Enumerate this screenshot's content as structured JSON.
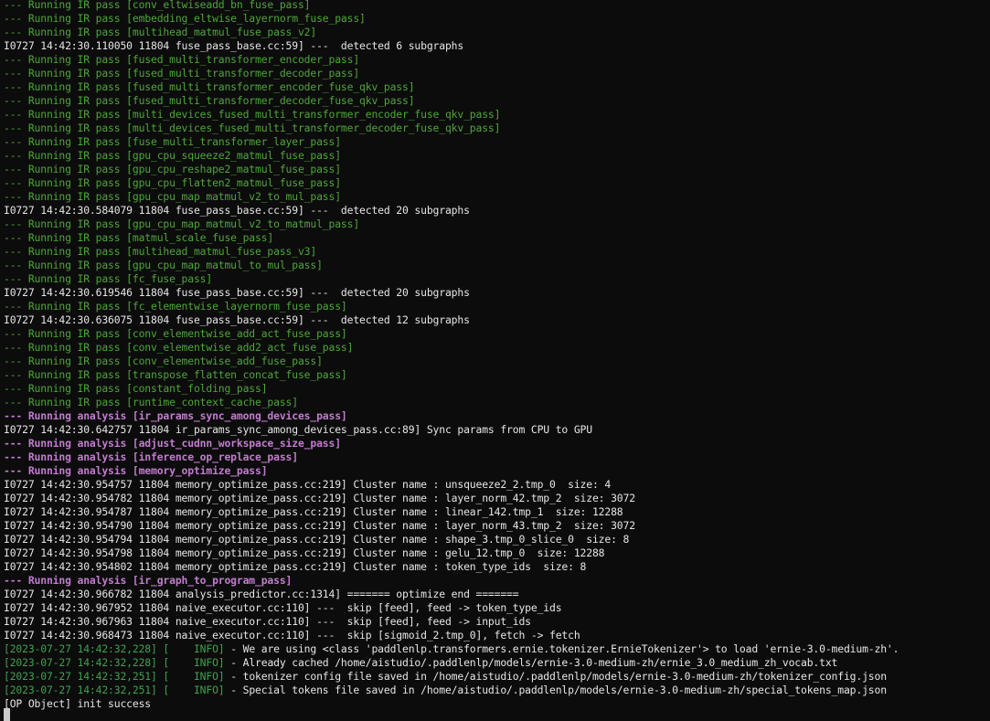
{
  "terminal": {
    "lines": [
      {
        "color": "green",
        "text": "--- Running IR pass [conv_eltwiseadd_bn_fuse_pass]"
      },
      {
        "color": "green",
        "text": "--- Running IR pass [embedding_eltwise_layernorm_fuse_pass]"
      },
      {
        "color": "green",
        "text": "--- Running IR pass [multihead_matmul_fuse_pass_v2]"
      },
      {
        "color": "white",
        "text": "I0727 14:42:30.110050 11804 fuse_pass_base.cc:59] ---  detected 6 subgraphs"
      },
      {
        "color": "green",
        "text": "--- Running IR pass [fused_multi_transformer_encoder_pass]"
      },
      {
        "color": "green",
        "text": "--- Running IR pass [fused_multi_transformer_decoder_pass]"
      },
      {
        "color": "green",
        "text": "--- Running IR pass [fused_multi_transformer_encoder_fuse_qkv_pass]"
      },
      {
        "color": "green",
        "text": "--- Running IR pass [fused_multi_transformer_decoder_fuse_qkv_pass]"
      },
      {
        "color": "green",
        "text": "--- Running IR pass [multi_devices_fused_multi_transformer_encoder_fuse_qkv_pass]"
      },
      {
        "color": "green",
        "text": "--- Running IR pass [multi_devices_fused_multi_transformer_decoder_fuse_qkv_pass]"
      },
      {
        "color": "green",
        "text": "--- Running IR pass [fuse_multi_transformer_layer_pass]"
      },
      {
        "color": "green",
        "text": "--- Running IR pass [gpu_cpu_squeeze2_matmul_fuse_pass]"
      },
      {
        "color": "green",
        "text": "--- Running IR pass [gpu_cpu_reshape2_matmul_fuse_pass]"
      },
      {
        "color": "green",
        "text": "--- Running IR pass [gpu_cpu_flatten2_matmul_fuse_pass]"
      },
      {
        "color": "green",
        "text": "--- Running IR pass [gpu_cpu_map_matmul_v2_to_mul_pass]"
      },
      {
        "color": "white",
        "text": "I0727 14:42:30.584079 11804 fuse_pass_base.cc:59] ---  detected 20 subgraphs"
      },
      {
        "color": "green",
        "text": "--- Running IR pass [gpu_cpu_map_matmul_v2_to_matmul_pass]"
      },
      {
        "color": "green",
        "text": "--- Running IR pass [matmul_scale_fuse_pass]"
      },
      {
        "color": "green",
        "text": "--- Running IR pass [multihead_matmul_fuse_pass_v3]"
      },
      {
        "color": "green",
        "text": "--- Running IR pass [gpu_cpu_map_matmul_to_mul_pass]"
      },
      {
        "color": "green",
        "text": "--- Running IR pass [fc_fuse_pass]"
      },
      {
        "color": "white",
        "text": "I0727 14:42:30.619546 11804 fuse_pass_base.cc:59] ---  detected 20 subgraphs"
      },
      {
        "color": "green",
        "text": "--- Running IR pass [fc_elementwise_layernorm_fuse_pass]"
      },
      {
        "color": "white",
        "text": "I0727 14:42:30.636075 11804 fuse_pass_base.cc:59] ---  detected 12 subgraphs"
      },
      {
        "color": "green",
        "text": "--- Running IR pass [conv_elementwise_add_act_fuse_pass]"
      },
      {
        "color": "green",
        "text": "--- Running IR pass [conv_elementwise_add2_act_fuse_pass]"
      },
      {
        "color": "green",
        "text": "--- Running IR pass [conv_elementwise_add_fuse_pass]"
      },
      {
        "color": "green",
        "text": "--- Running IR pass [transpose_flatten_concat_fuse_pass]"
      },
      {
        "color": "green",
        "text": "--- Running IR pass [constant_folding_pass]"
      },
      {
        "color": "green",
        "text": "--- Running IR pass [runtime_context_cache_pass]"
      },
      {
        "color": "purple",
        "text": "--- Running analysis [ir_params_sync_among_devices_pass]"
      },
      {
        "color": "white",
        "text": "I0727 14:42:30.642757 11804 ir_params_sync_among_devices_pass.cc:89] Sync params from CPU to GPU"
      },
      {
        "color": "purple",
        "text": "--- Running analysis [adjust_cudnn_workspace_size_pass]"
      },
      {
        "color": "purple",
        "text": "--- Running analysis [inference_op_replace_pass]"
      },
      {
        "color": "purple",
        "text": "--- Running analysis [memory_optimize_pass]"
      },
      {
        "color": "white",
        "text": "I0727 14:42:30.954757 11804 memory_optimize_pass.cc:219] Cluster name : unsqueeze2_2.tmp_0  size: 4"
      },
      {
        "color": "white",
        "text": "I0727 14:42:30.954782 11804 memory_optimize_pass.cc:219] Cluster name : layer_norm_42.tmp_2  size: 3072"
      },
      {
        "color": "white",
        "text": "I0727 14:42:30.954787 11804 memory_optimize_pass.cc:219] Cluster name : linear_142.tmp_1  size: 12288"
      },
      {
        "color": "white",
        "text": "I0727 14:42:30.954790 11804 memory_optimize_pass.cc:219] Cluster name : layer_norm_43.tmp_2  size: 3072"
      },
      {
        "color": "white",
        "text": "I0727 14:42:30.954794 11804 memory_optimize_pass.cc:219] Cluster name : shape_3.tmp_0_slice_0  size: 8"
      },
      {
        "color": "white",
        "text": "I0727 14:42:30.954798 11804 memory_optimize_pass.cc:219] Cluster name : gelu_12.tmp_0  size: 12288"
      },
      {
        "color": "white",
        "text": "I0727 14:42:30.954802 11804 memory_optimize_pass.cc:219] Cluster name : token_type_ids  size: 8"
      },
      {
        "color": "purple",
        "text": "--- Running analysis [ir_graph_to_program_pass]"
      },
      {
        "color": "white",
        "text": "I0727 14:42:30.966782 11804 analysis_predictor.cc:1314] ======= optimize end ======="
      },
      {
        "color": "white",
        "text": "I0727 14:42:30.967952 11804 naive_executor.cc:110] ---  skip [feed], feed -> token_type_ids"
      },
      {
        "color": "white",
        "text": "I0727 14:42:30.967963 11804 naive_executor.cc:110] ---  skip [feed], feed -> input_ids"
      },
      {
        "color": "white",
        "text": "I0727 14:42:30.968473 11804 naive_executor.cc:110] ---  skip [sigmoid_2.tmp_0], fetch -> fetch"
      },
      {
        "color": "info",
        "prefix": "[2023-07-27 14:42:32,228] [    INFO]",
        "text": " - We are using <class 'paddlenlp.transformers.ernie.tokenizer.ErnieTokenizer'> to load 'ernie-3.0-medium-zh'."
      },
      {
        "color": "info",
        "prefix": "[2023-07-27 14:42:32,228] [    INFO]",
        "text": " - Already cached /home/aistudio/.paddlenlp/models/ernie-3.0-medium-zh/ernie_3.0_medium_zh_vocab.txt"
      },
      {
        "color": "info",
        "prefix": "[2023-07-27 14:42:32,251] [    INFO]",
        "text": " - tokenizer config file saved in /home/aistudio/.paddlenlp/models/ernie-3.0-medium-zh/tokenizer_config.json"
      },
      {
        "color": "info",
        "prefix": "[2023-07-27 14:42:32,251] [    INFO]",
        "text": " - Special tokens file saved in /home/aistudio/.paddlenlp/models/ernie-3.0-medium-zh/special_tokens_map.json"
      },
      {
        "color": "white",
        "text": "[OP Object] init success"
      }
    ]
  },
  "colors": {
    "background": "#0c0c0c",
    "green": "#4ea63a",
    "white": "#e6e6e6",
    "purple": "#c27ccf",
    "info": "#3fa14f"
  }
}
